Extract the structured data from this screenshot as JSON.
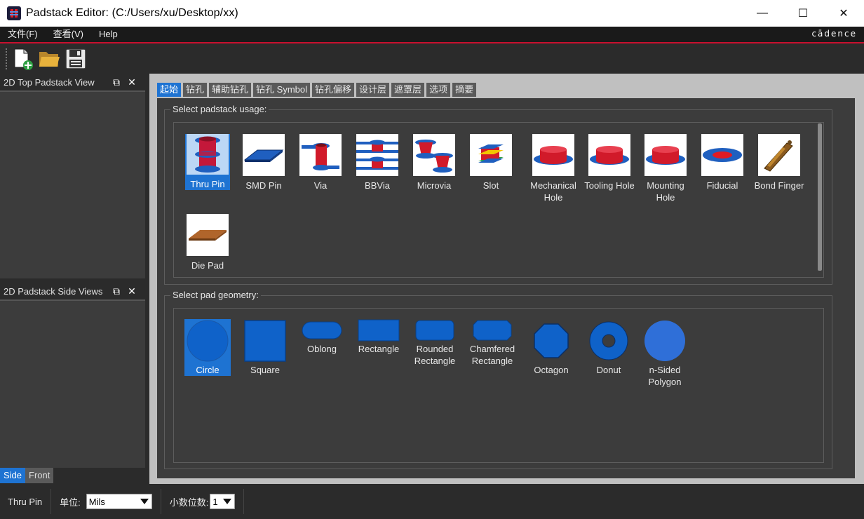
{
  "window": {
    "title": "Padstack Editor:   (C:/Users/xu/Desktop/xx)",
    "minimize": "—",
    "maximize": "☐",
    "close": "✕"
  },
  "menu": {
    "items": [
      "文件(F)",
      "查看(V)",
      "Help"
    ],
    "brand": "cādence"
  },
  "toolbar": {
    "icons": [
      "new-file-icon",
      "open-folder-icon",
      "save-icon"
    ]
  },
  "left_dock": {
    "top_panel_title": "2D Top Padstack View",
    "side_panel_title": "2D Padstack Side Views",
    "float_glyph": "⧉",
    "close_glyph": "✕",
    "side_tabs": [
      {
        "label": "Side",
        "active": true
      },
      {
        "label": "Front",
        "active": false
      }
    ]
  },
  "tabs": [
    {
      "label": "起始",
      "active": true
    },
    {
      "label": "钻孔",
      "active": false
    },
    {
      "label": "辅助钻孔",
      "active": false
    },
    {
      "label": "钻孔 Symbol",
      "active": false
    },
    {
      "label": "钻孔偏移",
      "active": false
    },
    {
      "label": "设计层",
      "active": false
    },
    {
      "label": "遮罩层",
      "active": false
    },
    {
      "label": "选项",
      "active": false
    },
    {
      "label": "摘要",
      "active": false
    }
  ],
  "usage": {
    "group_label": "Select padstack usage:",
    "items": [
      {
        "label": "Thru Pin",
        "icon": "thru-pin-icon",
        "selected": true
      },
      {
        "label": "SMD Pin",
        "icon": "smd-pin-icon",
        "selected": false
      },
      {
        "label": "Via",
        "icon": "via-icon",
        "selected": false
      },
      {
        "label": "BBVia",
        "icon": "bbvia-icon",
        "selected": false
      },
      {
        "label": "Microvia",
        "icon": "microvia-icon",
        "selected": false
      },
      {
        "label": "Slot",
        "icon": "slot-icon",
        "selected": false
      },
      {
        "label": "Mechanical Hole",
        "icon": "mechanical-hole-icon",
        "selected": false
      },
      {
        "label": "Tooling Hole",
        "icon": "tooling-hole-icon",
        "selected": false
      },
      {
        "label": "Mounting Hole",
        "icon": "mounting-hole-icon",
        "selected": false
      },
      {
        "label": "Fiducial",
        "icon": "fiducial-icon",
        "selected": false
      },
      {
        "label": "Bond Finger",
        "icon": "bond-finger-icon",
        "selected": false
      },
      {
        "label": "Die Pad",
        "icon": "die-pad-icon",
        "selected": false
      }
    ]
  },
  "geometry": {
    "group_label": "Select pad geometry:",
    "items": [
      {
        "label": "Circle",
        "icon": "circle-shape-icon",
        "selected": true
      },
      {
        "label": "Square",
        "icon": "square-shape-icon",
        "selected": false
      },
      {
        "label": "Oblong",
        "icon": "oblong-shape-icon",
        "selected": false
      },
      {
        "label": "Rectangle",
        "icon": "rectangle-shape-icon",
        "selected": false
      },
      {
        "label": "Rounded Rectangle",
        "icon": "rounded-rectangle-shape-icon",
        "selected": false
      },
      {
        "label": "Chamfered Rectangle",
        "icon": "chamfered-rectangle-shape-icon",
        "selected": false
      },
      {
        "label": "Octagon",
        "icon": "octagon-shape-icon",
        "selected": false
      },
      {
        "label": "Donut",
        "icon": "donut-shape-icon",
        "selected": false
      },
      {
        "label": "n-Sided Polygon",
        "icon": "polygon-shape-icon",
        "selected": false
      }
    ]
  },
  "status": {
    "current_usage": "Thru Pin",
    "units_label": "单位:",
    "units_value": "Mils",
    "decimals_label": "小数位数:",
    "decimals_value": "1"
  },
  "colors": {
    "accent": "#1e73d2",
    "brand_line": "#c8102e",
    "pad_red": "#e01b24",
    "pad_blue": "#1f5fbf"
  }
}
